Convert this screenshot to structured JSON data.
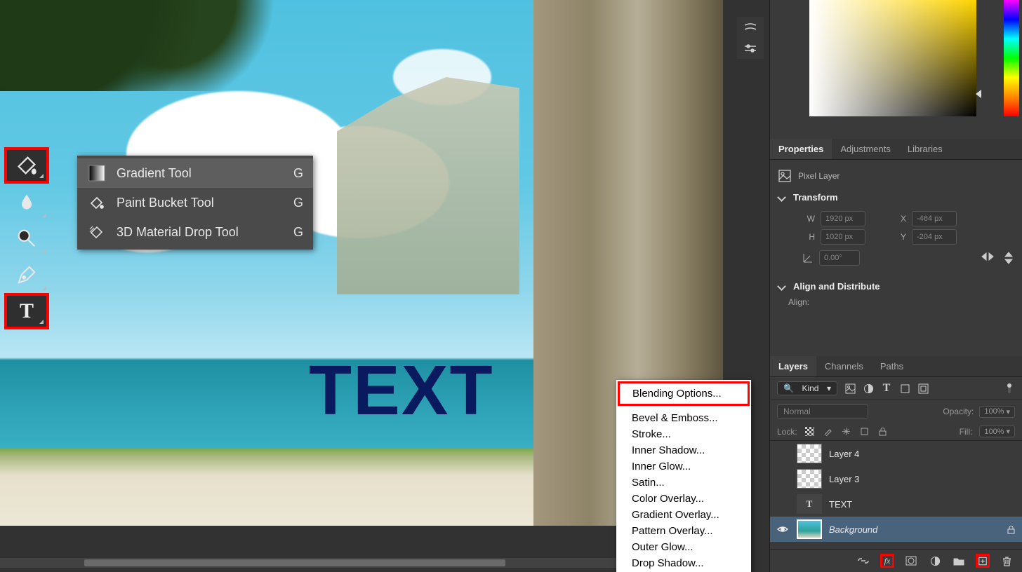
{
  "canvas": {
    "overlay_text": "TEXT"
  },
  "toolbar": {
    "tools": [
      "gradient-tool",
      "blur-tool",
      "zoom-tool",
      "pen-tool",
      "type-tool"
    ],
    "flyout": {
      "items": [
        {
          "label": "Gradient Tool",
          "shortcut": "G",
          "icon": "gradient-swatch"
        },
        {
          "label": "Paint Bucket Tool",
          "shortcut": "G",
          "icon": "paint-bucket"
        },
        {
          "label": "3D Material Drop Tool",
          "shortcut": "G",
          "icon": "material-drop"
        }
      ]
    }
  },
  "fx_menu": {
    "items": [
      "Blending Options...",
      "Bevel & Emboss...",
      "Stroke...",
      "Inner Shadow...",
      "Inner Glow...",
      "Satin...",
      "Color Overlay...",
      "Gradient Overlay...",
      "Pattern Overlay...",
      "Outer Glow...",
      "Drop Shadow..."
    ]
  },
  "panels": {
    "properties": {
      "tabs": [
        "Properties",
        "Adjustments",
        "Libraries"
      ],
      "kind_label": "Pixel Layer",
      "sections": {
        "transform": {
          "title": "Transform",
          "w_label": "W",
          "w_value": "1920 px",
          "h_label": "H",
          "h_value": "1020 px",
          "x_label": "X",
          "x_value": "-464 px",
          "y_label": "Y",
          "y_value": "-204 px",
          "angle_value": "0.00°"
        },
        "align": {
          "title": "Align and Distribute",
          "row_label": "Align:"
        }
      }
    },
    "layers": {
      "tabs": [
        "Layers",
        "Channels",
        "Paths"
      ],
      "filter_label": "Kind",
      "blend_mode": "Normal",
      "opacity_label": "Opacity:",
      "opacity_value": "100%",
      "lock_label": "Lock:",
      "fill_label": "Fill:",
      "fill_value": "100%",
      "items": [
        {
          "name": "Layer 4",
          "kind": "pixel",
          "visible": false
        },
        {
          "name": "Layer 3",
          "kind": "pixel",
          "visible": false
        },
        {
          "name": "TEXT",
          "kind": "text",
          "visible": false
        },
        {
          "name": "Background",
          "kind": "bg",
          "visible": true,
          "locked": true
        }
      ],
      "footer_icons": [
        "link",
        "fx",
        "mask",
        "adjustment",
        "group",
        "new",
        "delete"
      ]
    }
  },
  "colors": {
    "highlight_red": "#ff0000"
  }
}
